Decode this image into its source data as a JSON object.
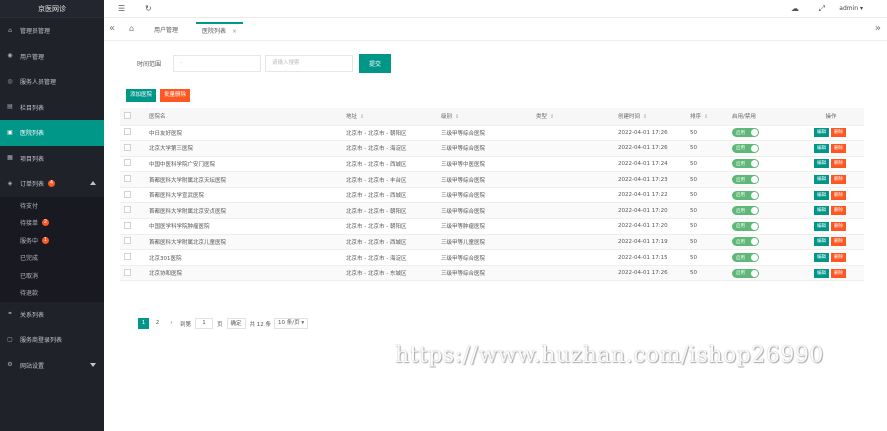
{
  "app": {
    "logo": "京医网诊"
  },
  "sidebar": {
    "items": [
      {
        "label": "管理员管理",
        "icon": "lock-icon"
      },
      {
        "label": "用户管理",
        "icon": "user-icon"
      },
      {
        "label": "服务人员管理",
        "icon": "users-icon"
      },
      {
        "label": "栏目列表",
        "icon": "list-icon"
      },
      {
        "label": "医院列表",
        "icon": "hospital-icon",
        "active": true
      },
      {
        "label": "项目列表",
        "icon": "grid-icon"
      },
      {
        "label": "订单列表",
        "icon": "order-icon",
        "badge": "4",
        "expanded": true
      },
      {
        "label": "关系列表",
        "icon": "link-icon"
      },
      {
        "label": "服务商登录列表",
        "icon": "login-icon"
      },
      {
        "label": "网站设置",
        "icon": "gear-icon"
      }
    ],
    "sub_items": [
      {
        "label": "待支付"
      },
      {
        "label": "待接单",
        "badge": "2"
      },
      {
        "label": "服务中",
        "badge": "1"
      },
      {
        "label": "已完成"
      },
      {
        "label": "已取消"
      },
      {
        "label": "待退款"
      }
    ]
  },
  "topbar": {
    "user": "admin"
  },
  "tabs": [
    {
      "label": "用户管理"
    },
    {
      "label": "医院列表",
      "active": true
    }
  ],
  "search": {
    "label": "时间范围",
    "date_value": "-",
    "keyword_placeholder": "请输入搜索",
    "submit_label": "提交"
  },
  "actions": {
    "add_label": "添加医院",
    "batch_delete_label": "批量删除"
  },
  "table": {
    "columns": [
      "医院名",
      "地址",
      "级别",
      "类型",
      "创建时间",
      "排序",
      "启用/禁用",
      "操作"
    ],
    "rows": [
      [
        "中日友好医院",
        "北京市 - 北京市 - 朝阳区",
        "三级甲等综合医院",
        "",
        "2022-04-01 17:26",
        "50"
      ],
      [
        "北京大学第三医院",
        "北京市 - 北京市 - 海淀区",
        "三级甲等综合医院",
        "",
        "2022-04-01 17:26",
        "50"
      ],
      [
        "中国中医科学院广安门医院",
        "北京市 - 北京市 - 西城区",
        "三级甲等中医医院",
        "",
        "2022-04-01 17:24",
        "50"
      ],
      [
        "首都医科大学附属北京天坛医院",
        "北京市 - 北京市 - 丰台区",
        "三级甲等综合医院",
        "",
        "2022-04-01 17:23",
        "50"
      ],
      [
        "首都医科大学宣武医院",
        "北京市 - 北京市 - 西城区",
        "三级甲等综合医院",
        "",
        "2022-04-01 17:22",
        "50"
      ],
      [
        "首都医科大学附属北京安贞医院",
        "北京市 - 北京市 - 朝阳区",
        "三级甲等综合医院",
        "",
        "2022-04-01 17:20",
        "50"
      ],
      [
        "中国医学科学院肿瘤医院",
        "北京市 - 北京市 - 朝阳区",
        "三级甲等肿瘤医院",
        "",
        "2022-04-01 17:20",
        "50"
      ],
      [
        "首都医科大学附属北京儿童医院",
        "北京市 - 北京市 - 西城区",
        "三级甲等儿童医院",
        "",
        "2022-04-01 17:19",
        "50"
      ],
      [
        "北京301医院",
        "北京市 - 北京市 - 海淀区",
        "三级甲等综合医院",
        "",
        "2022-04-01 17:15",
        "50"
      ],
      [
        "北京协和医院",
        "北京市 - 北京市 - 东城区",
        "三级甲等综合医院",
        "",
        "2022-04-01 17:26",
        "50"
      ]
    ],
    "switch_label": "启用",
    "edit_label": "编辑",
    "delete_label": "删除"
  },
  "pager": {
    "pages": [
      "1",
      "2"
    ],
    "current": "1",
    "next": "›",
    "goto_label": "到第",
    "goto_value": "1",
    "page_unit": "页",
    "confirm_label": "确定",
    "total_label": "共 12 条",
    "per_page_label": "10 条/页"
  },
  "watermark": "https://www.huzhan.com/ishop26990"
}
